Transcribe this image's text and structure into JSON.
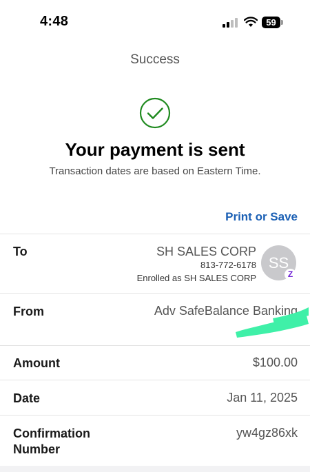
{
  "status_bar": {
    "time": "4:48",
    "battery": "59"
  },
  "nav": {
    "title": "Success"
  },
  "confirmation": {
    "headline": "Your payment is sent",
    "subtext": "Transaction dates are based on Eastern Time."
  },
  "actions": {
    "print_or_save": "Print or Save"
  },
  "details": {
    "to": {
      "label": "To",
      "name": "SH SALES CORP",
      "phone": "813-772-6178",
      "enrolled": "Enrolled as SH SALES CORP",
      "avatar_initials": "SS",
      "badge": "Z"
    },
    "from": {
      "label": "From",
      "value": "Adv SafeBalance Banking"
    },
    "amount": {
      "label": "Amount",
      "value": "$100.00"
    },
    "date": {
      "label": "Date",
      "value": "Jan 11, 2025"
    },
    "confirmation_number": {
      "label_line1": "Confirmation",
      "label_line2": "Number",
      "value": "yw4gz86xk"
    }
  },
  "colors": {
    "success_green": "#1f8a1f",
    "link_blue": "#1a5fb4",
    "zelle_purple": "#6d1ed4",
    "redaction_mint": "#3ff0a8"
  },
  "icons": [
    "cellular-signal-icon",
    "wifi-icon",
    "battery-icon",
    "checkmark-circle-icon",
    "zelle-icon"
  ]
}
